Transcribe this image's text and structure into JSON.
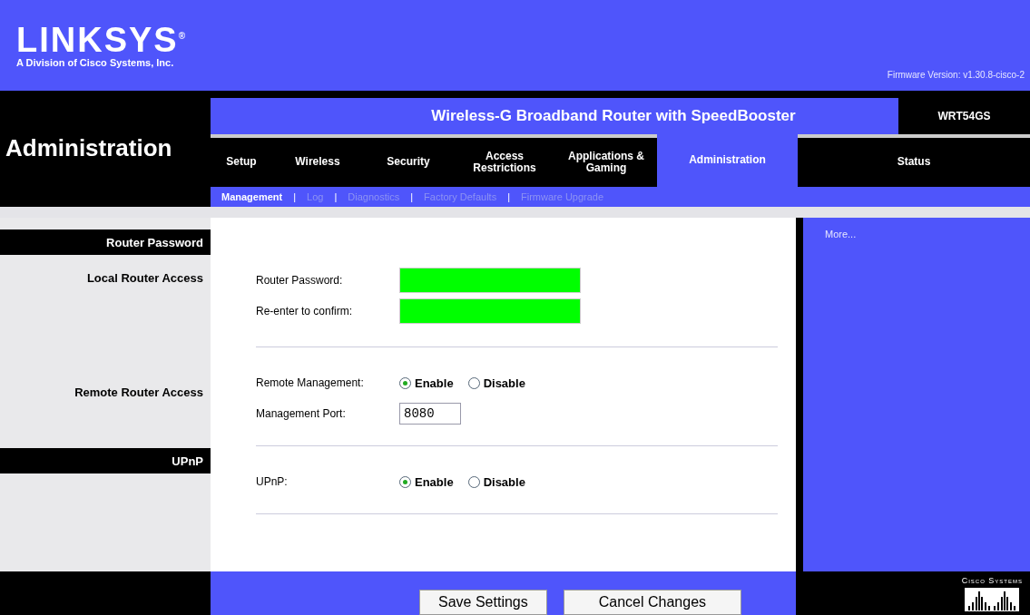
{
  "header": {
    "logo": "LINKSYS",
    "logo_mark": "®",
    "tagline": "A Division of Cisco Systems, Inc.",
    "firmware": "Firmware Version: v1.30.8-cisco-2"
  },
  "page_title": "Administration",
  "product": {
    "name": "Wireless-G Broadband Router with SpeedBooster",
    "model": "WRT54GS"
  },
  "tabs": [
    {
      "label": "Setup",
      "selected": false
    },
    {
      "label": "Wireless",
      "selected": false
    },
    {
      "label": "Security",
      "selected": false
    },
    {
      "label": "Access Restrictions",
      "selected": false
    },
    {
      "label": "Applications & Gaming",
      "selected": false
    },
    {
      "label": "Administration",
      "selected": true
    },
    {
      "label": "Status",
      "selected": false
    }
  ],
  "sub_nav": {
    "separator": "|",
    "items": [
      {
        "label": "Management",
        "selected": true
      },
      {
        "label": "Log",
        "selected": false
      },
      {
        "label": "Diagnostics",
        "selected": false
      },
      {
        "label": "Factory Defaults",
        "selected": false
      },
      {
        "label": "Firmware Upgrade",
        "selected": false
      }
    ]
  },
  "sidebar": [
    {
      "kind": "header",
      "label": "Router Password"
    },
    {
      "kind": "label",
      "label": "Local Router Access"
    },
    {
      "kind": "label",
      "label": "Remote Router Access"
    },
    {
      "kind": "header",
      "label": "UPnP"
    }
  ],
  "sections": [
    {
      "rows": [
        {
          "kind": "password",
          "label": "Router Password:"
        },
        {
          "kind": "password",
          "label": "Re-enter to confirm:"
        }
      ]
    },
    {
      "rows": [
        {
          "kind": "radio",
          "label": "Remote Management:",
          "options": [
            {
              "label": "Enable",
              "selected": true
            },
            {
              "label": "Disable",
              "selected": false
            }
          ]
        },
        {
          "kind": "text",
          "label": "Management Port:",
          "value": "8080"
        }
      ]
    },
    {
      "rows": [
        {
          "kind": "radio",
          "label": "UPnP:",
          "options": [
            {
              "label": "Enable",
              "selected": true
            },
            {
              "label": "Disable",
              "selected": false
            }
          ]
        }
      ]
    }
  ],
  "help": {
    "link": "More..."
  },
  "buttons": [
    "Save Settings",
    "Cancel Changes"
  ],
  "brand": "Cisco Systems"
}
